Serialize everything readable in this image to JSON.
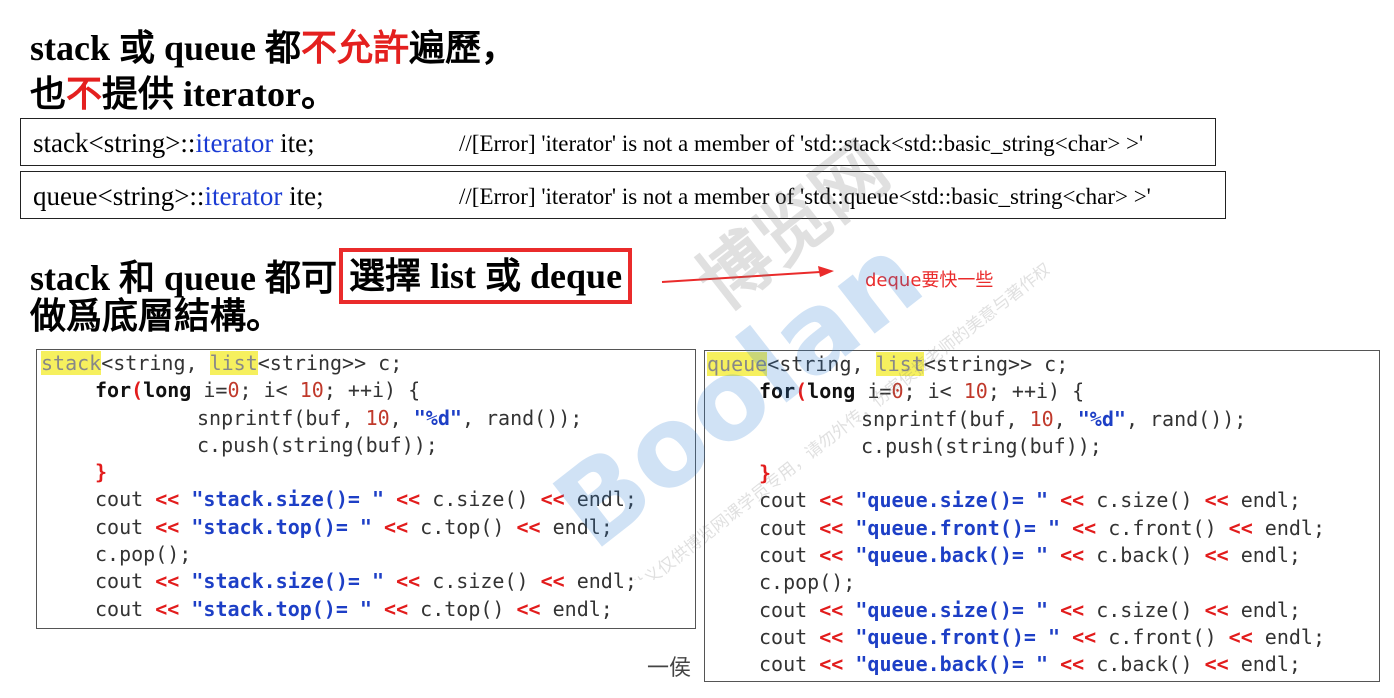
{
  "headings": {
    "line1_a": "stack 或 queue 都",
    "line1_b": "不允許",
    "line1_c": "遍歷，",
    "line2_a": "也",
    "line2_b": "不",
    "line2_c": "提供 iterator。",
    "line3_a": "stack 和 queue 都可",
    "line3_b": "選擇 list 或 deque",
    "line4": "做爲底層結構。"
  },
  "errors": [
    {
      "pre": "stack<string>::",
      "mid": "iterator",
      "post": " ite;",
      "msg": "//[Error] 'iterator' is not a member of 'std::stack<std::basic_string<char> >'"
    },
    {
      "pre": "queue<string>::",
      "mid": "iterator",
      "post": " ite;",
      "msg": "//[Error] 'iterator' is not a member of 'std::queue<std::basic_string<char> >'"
    }
  ],
  "annotation": "deque要快一些",
  "footer": "一侯",
  "watermark": {
    "brand": "Boolan",
    "cn": "博览网",
    "notice": "本讲义仅供博览网课学员专用，请勿外传，伤害侯捷老师的美意与著作权。"
  },
  "code_left": {
    "l1_a": "stack",
    "l1_b": "<string, ",
    "l1_c": "list",
    "l1_d": "<string>> c;",
    "for_kw": "for",
    "for_a": "(",
    "for_long": "long",
    "for_b": " i=",
    "for_n0": "0",
    "for_c": "; i< ",
    "for_n10": "10",
    "for_d": "; ++i) {",
    "sn_a": "snprintf(buf, ",
    "sn_n": "10",
    "sn_b": ", ",
    "sn_s": "\"%d\"",
    "sn_c": ", rand());",
    "push": "c.push(string(buf));",
    "close": "}",
    "cout": "cout ",
    "op": "<<",
    "sp": " ",
    "size_s": "\"stack.size()= \"",
    "top_s": "\"stack.top()= \"",
    "csize": " c.size() ",
    "ctop": " c.top() ",
    "endl": " endl;",
    "pop": "c.pop();"
  },
  "code_right": {
    "l1_a": "queue",
    "l1_b": "<string, ",
    "l1_c": "list",
    "l1_d": "<string>> c;",
    "size_s": "\"queue.size()= \"",
    "front_s": "\"queue.front()= \"",
    "back_s": "\"queue.back()= \"",
    "csize": " c.size() ",
    "cfront": " c.front() ",
    "cback": " c.back() "
  }
}
